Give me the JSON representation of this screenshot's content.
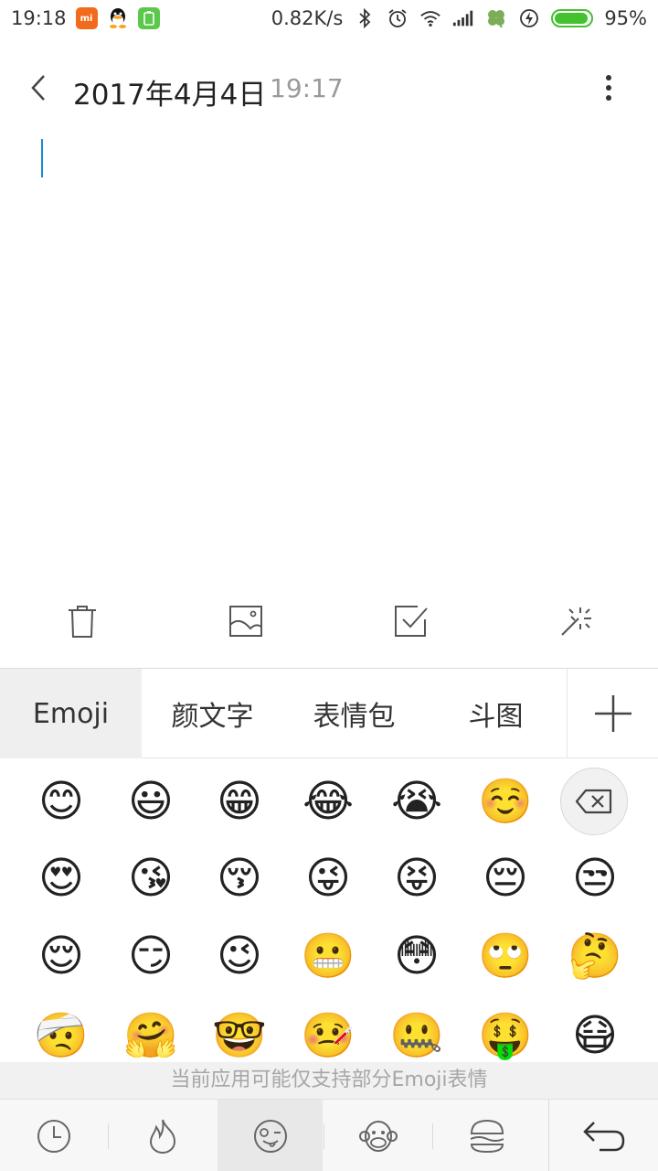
{
  "status_bar": {
    "time": "19:18",
    "net_speed": "0.82K/s",
    "battery_percent": "95%",
    "battery_level": 0.95,
    "icons": [
      "mi-app-icon",
      "qq-icon",
      "battery-app-icon",
      "bluetooth-icon",
      "alarm-icon",
      "wifi-icon",
      "signal-icon",
      "clover-icon",
      "charging-icon"
    ]
  },
  "header": {
    "date": "2017年4月4日",
    "time": "19:17"
  },
  "editor": {
    "content": ""
  },
  "note_toolbar": [
    "trash-icon",
    "image-icon",
    "checkbox-icon",
    "magic-wand-icon"
  ],
  "keyboard": {
    "tabs": [
      {
        "label": "Emoji",
        "active": true
      },
      {
        "label": "颜文字",
        "active": false
      },
      {
        "label": "表情包",
        "active": false
      },
      {
        "label": "斗图",
        "active": false
      }
    ],
    "emojis": [
      [
        "😊",
        "😃",
        "😁",
        "😂",
        "😭",
        "☺️"
      ],
      [
        "😍",
        "😘",
        "😚",
        "😜",
        "😝",
        "😔",
        "😒"
      ],
      [
        "😌",
        "😏",
        "😉",
        "😬",
        "😳",
        "🙄",
        "🤔"
      ],
      [
        "🤕",
        "🤗",
        "🤓",
        "🤒",
        "🤐",
        "🤑",
        "😷"
      ]
    ],
    "notice": "当前应用可能仅支持部分Emoji表情",
    "categories": [
      "recent-icon",
      "fire-icon",
      "winking-face-icon",
      "monkey-icon",
      "burger-icon"
    ],
    "active_category": 2
  }
}
